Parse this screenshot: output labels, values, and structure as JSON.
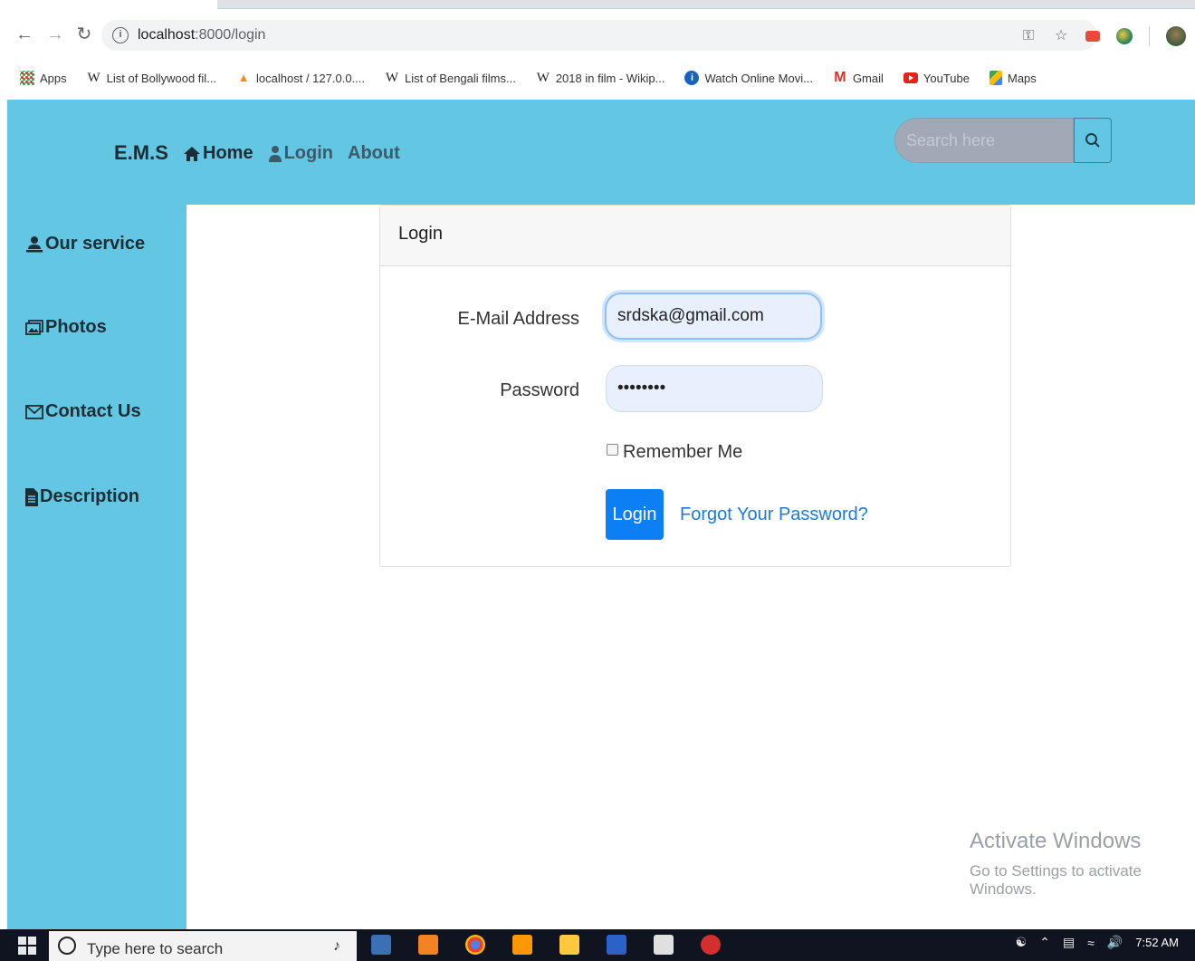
{
  "browser": {
    "url_host": "localhost",
    "url_path": ":8000/login",
    "bookmarks": [
      {
        "label": "Apps",
        "icon": "apps-grid-icon"
      },
      {
        "label": "List of Bollywood fil...",
        "icon": "wikipedia-icon"
      },
      {
        "label": "localhost / 127.0.0....",
        "icon": "phpmyadmin-icon"
      },
      {
        "label": "List of Bengali films...",
        "icon": "wikipedia-icon"
      },
      {
        "label": "2018 in film - Wikip...",
        "icon": "wikipedia-icon"
      },
      {
        "label": "Watch Online Movi...",
        "icon": "watch-online-icon"
      },
      {
        "label": "Gmail",
        "icon": "gmail-icon"
      },
      {
        "label": "YouTube",
        "icon": "youtube-icon"
      },
      {
        "label": "Maps",
        "icon": "maps-icon"
      }
    ]
  },
  "header": {
    "brand": "E.M.S",
    "nav": {
      "home": "Home",
      "login": "Login",
      "about": "About"
    },
    "search_placeholder": "Search here"
  },
  "sidebar": {
    "items": [
      {
        "label": "Our service",
        "icon": "user-service-icon"
      },
      {
        "label": "Photos",
        "icon": "photos-icon"
      },
      {
        "label": "Contact Us",
        "icon": "envelope-icon"
      },
      {
        "label": "Description",
        "icon": "document-icon"
      }
    ]
  },
  "login_card": {
    "title": "Login",
    "email_label": "E-Mail Address",
    "email_value": "srdska@gmail.com",
    "password_label": "Password",
    "password_value": "••••••••",
    "remember_label": "Remember Me",
    "submit_label": "Login",
    "forgot_label": "Forgot Your Password?"
  },
  "watermark": {
    "title": "Activate Windows",
    "subtitle": "Go to Settings to activate Windows."
  },
  "taskbar": {
    "search_text": "Type here to search",
    "time": "7:52 AM"
  },
  "colors": {
    "accent": "#63c7e4",
    "button": "#0d7ff5",
    "link": "#1a7ae0"
  }
}
